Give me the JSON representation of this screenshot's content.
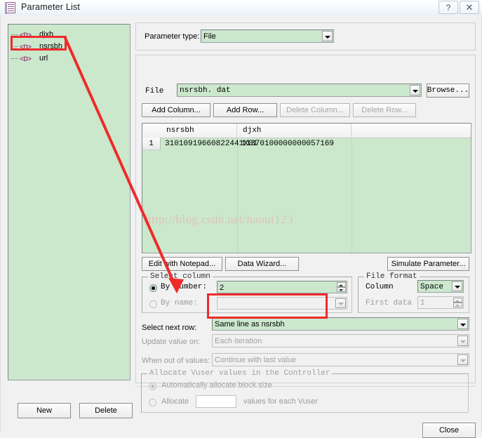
{
  "window": {
    "title": "Parameter List",
    "icon": "document-list-icon",
    "help_label": "?",
    "close_label": "✕"
  },
  "tree": {
    "items": [
      {
        "tag": "<D>",
        "label": "djxh",
        "selected": true
      },
      {
        "tag": "<D>",
        "label": "nsrsbh",
        "selected": false
      },
      {
        "tag": "<D>",
        "label": "url",
        "selected": false
      }
    ],
    "new_label": "New",
    "delete_label": "Delete"
  },
  "parameter_type": {
    "label": "Parameter type:",
    "value": "File"
  },
  "file": {
    "label": "File",
    "value": "nsrsbh. dat",
    "browse_label": "Browse..."
  },
  "table_buttons": {
    "add_column": "Add Column...",
    "add_row": "Add Row...",
    "delete_column": "Delete Column...",
    "delete_row": "Delete Row..."
  },
  "table": {
    "columns": [
      "nsrsbh",
      "djxh"
    ],
    "rows": [
      {
        "index": "1",
        "cells": [
          "31010919660822441X01",
          "11370100000000057169"
        ]
      }
    ]
  },
  "tools": {
    "edit_with_notepad": "Edit with Notepad...",
    "data_wizard": "Data Wizard...",
    "simulate_parameter": "Simulate Parameter..."
  },
  "select_column": {
    "group_label": "Select column",
    "by_number_label": "By number:",
    "by_number_value": "2",
    "by_number_selected": true,
    "by_name_label": "By name:",
    "by_name_value": "",
    "by_name_selected": false
  },
  "file_format": {
    "group_label": "File format",
    "column_label": "Column",
    "column_value": "Space",
    "first_data_label": "First data",
    "first_data_value": "1"
  },
  "row_options": {
    "select_next_row_label": "Select next row:",
    "select_next_row_value": "Same line as nsrsbh",
    "update_value_on_label": "Update value on:",
    "update_value_on_value": "Each iteration",
    "when_out_of_values_label": "When out of values:",
    "when_out_of_values_value": "Continue with last value"
  },
  "allocate": {
    "group_label": "Allocate Vuser values in the Controller",
    "auto_label": "Automatically allocate block size",
    "auto_selected": true,
    "allocate_label": "Allocate",
    "allocate_value": "",
    "allocate_suffix": "values for each Vuser"
  },
  "footer": {
    "close_label": "Close"
  },
  "watermark": {
    "text": "http://blog.csdn.net/haoui123"
  },
  "annotations": {
    "accent_color": "#ee2b2b",
    "field_color": "#cbe8cd"
  }
}
